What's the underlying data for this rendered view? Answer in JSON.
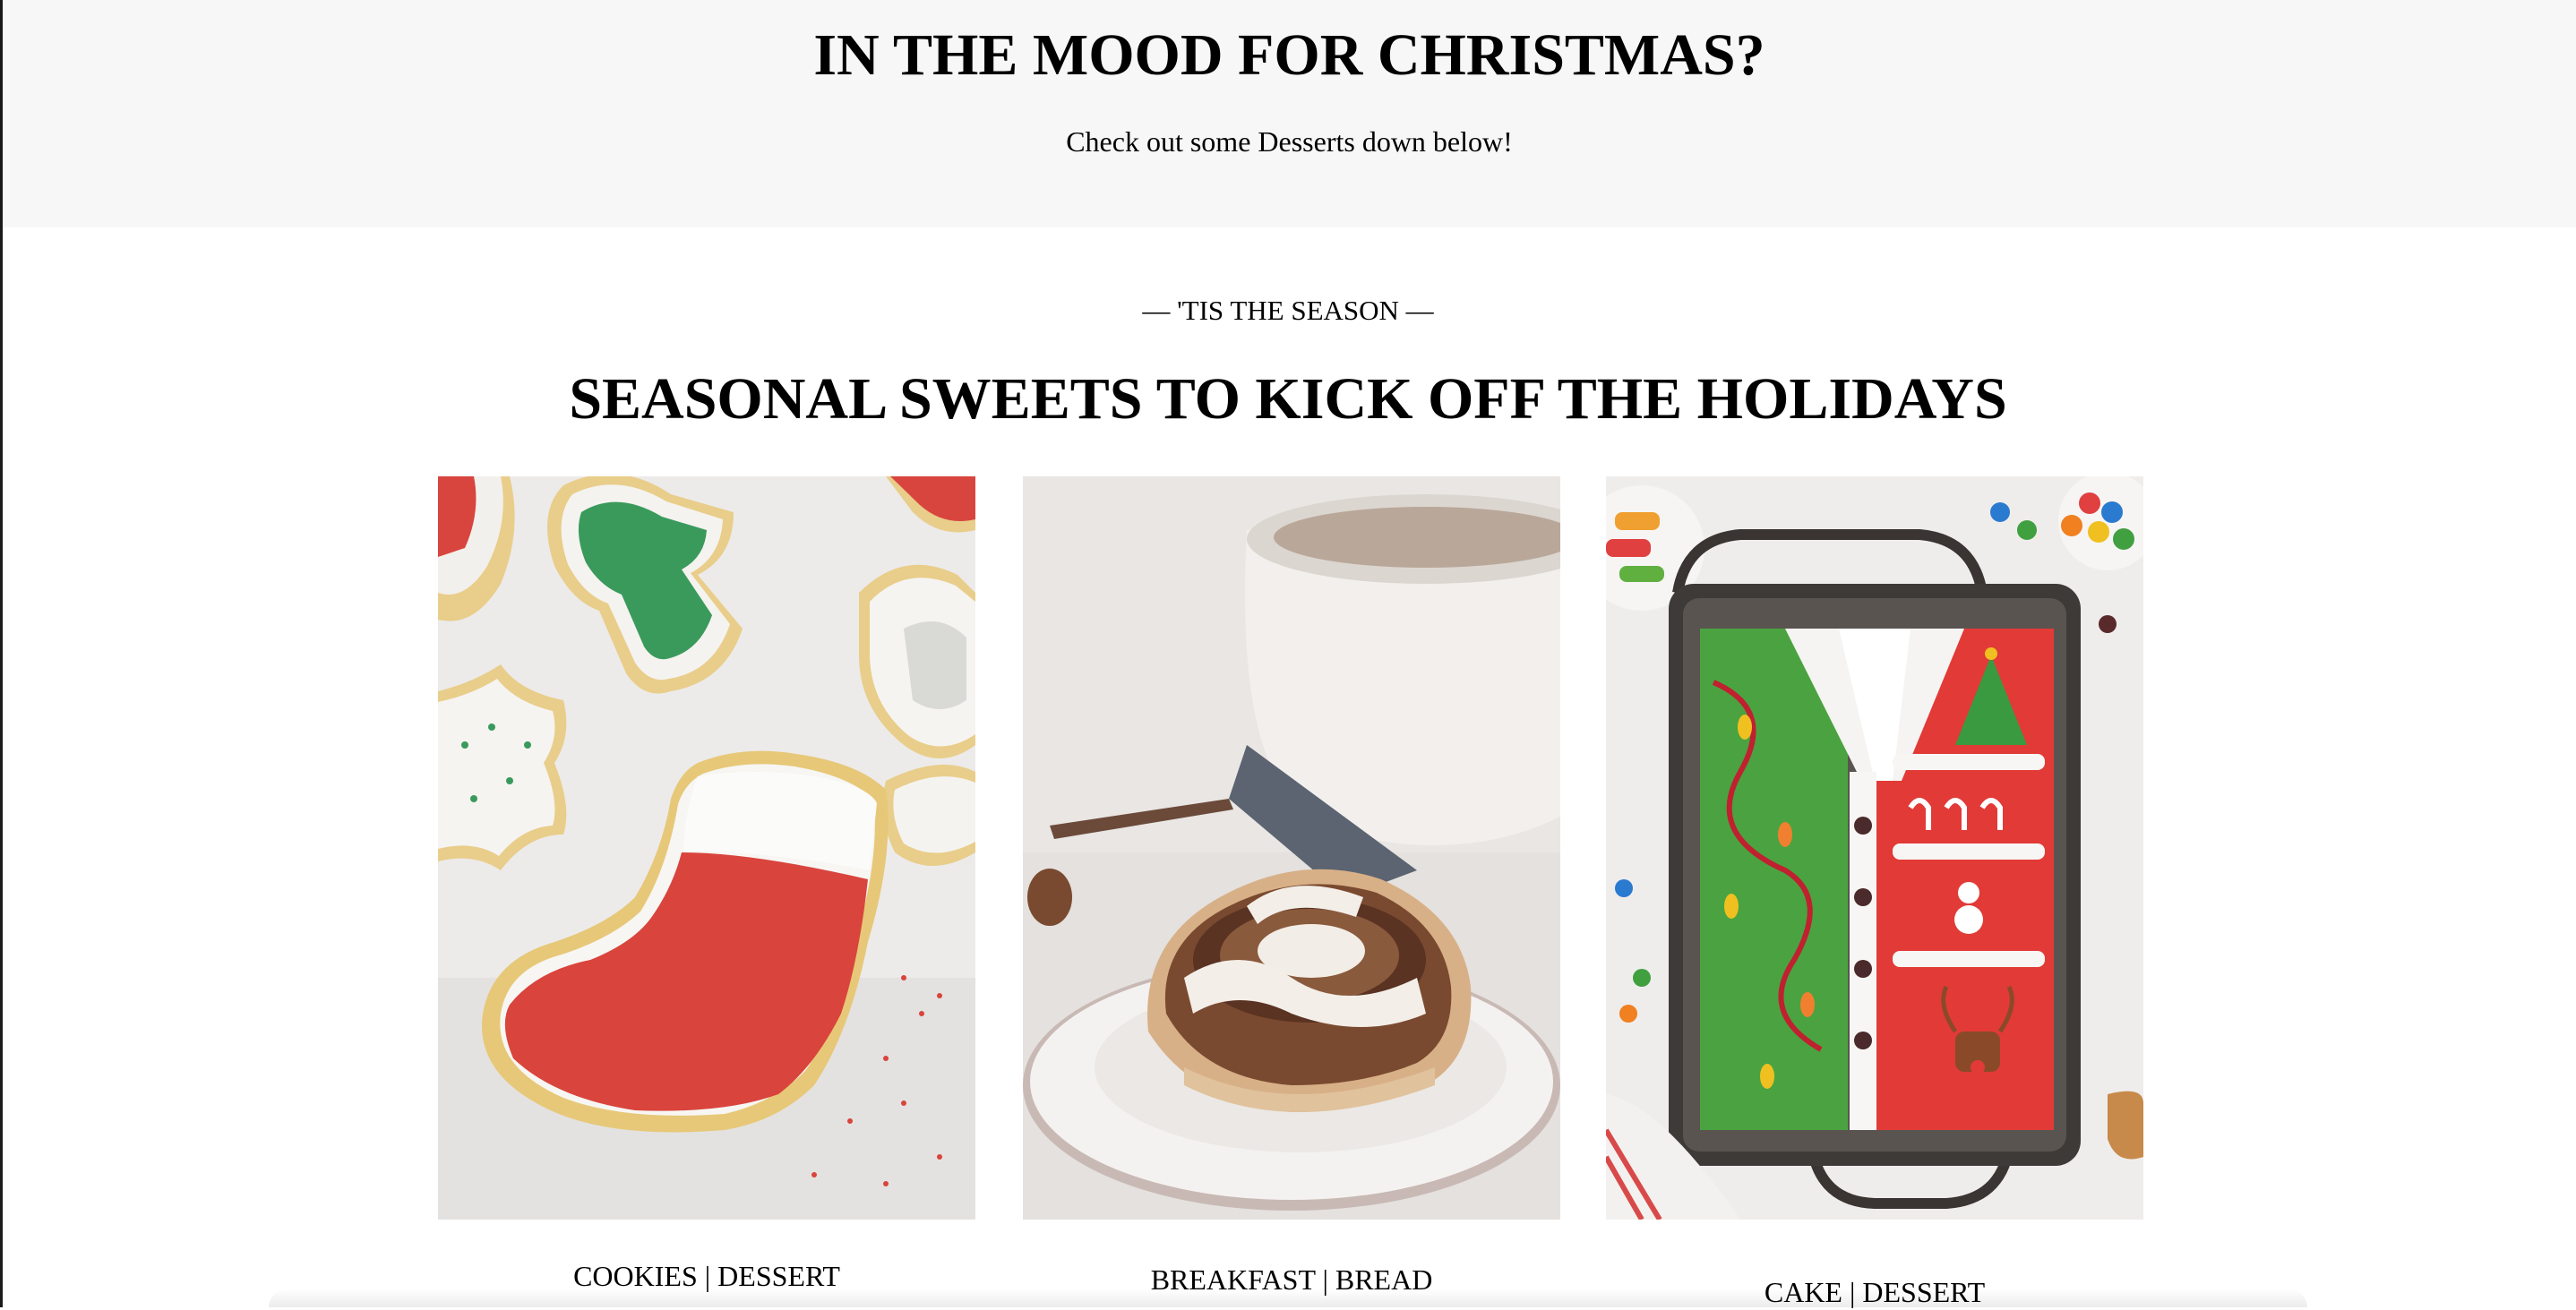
{
  "hero": {
    "title": "IN THE MOOD FOR CHRISTMAS?",
    "subtitle": "Check out some Desserts down below!"
  },
  "section": {
    "eyebrow": "— 'TIS THE SEASON —",
    "title": "SEASONAL SWEETS TO KICK OFF THE HOLIDAYS"
  },
  "cards": [
    {
      "tag": "COOKIES | DESSERT"
    },
    {
      "tag": "BREAKFAST | BREAD"
    },
    {
      "tag": "CAKE | DESSERT"
    }
  ],
  "colors": {
    "hero_background": "#f7f7f7",
    "page_background": "#ffffff",
    "text": "#000000"
  }
}
